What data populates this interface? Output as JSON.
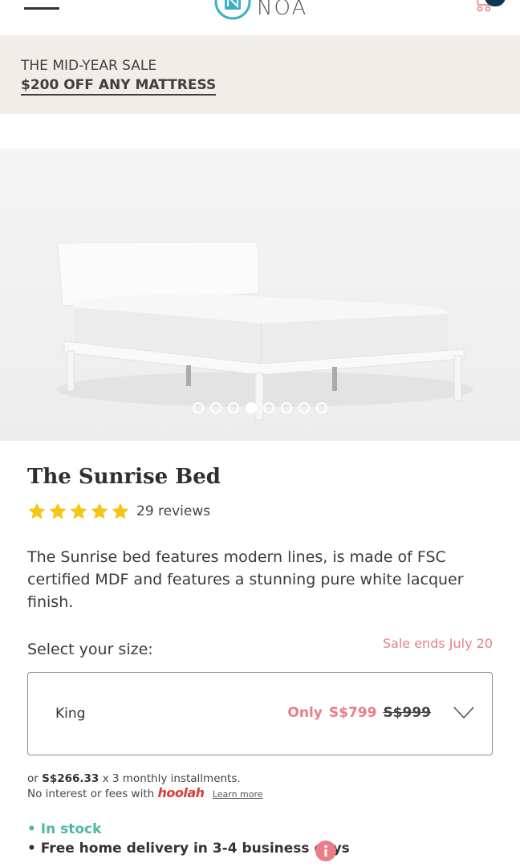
{
  "header": {
    "logo_text": "NOA",
    "cart_count": "0",
    "icons": {
      "menu": "hamburger-menu-icon",
      "cart": "cart-icon",
      "logo": "noa-logo-mark"
    }
  },
  "promo": {
    "line1": "THE MID-YEAR SALE",
    "line2": "$200 OFF ANY MATTRESS",
    "background": "#f1ede8"
  },
  "gallery": {
    "slide_count": 8,
    "active_index": 3
  },
  "product": {
    "title": "The Sunrise Bed",
    "rating": 5,
    "reviews": "29 reviews",
    "description": "The Sunrise bed features modern lines, is made of FSC certified MDF and features a stunning pure white lacquer finish."
  },
  "size": {
    "label": "Select your size:",
    "sale_ends": "Sale ends July 20",
    "selected": "King",
    "only": "Only",
    "price_now": "S$799",
    "price_was": "S$999"
  },
  "installments": {
    "prefix": "or",
    "amount": "S$266.33",
    "suffix": "x 3 monthly installments.",
    "line2": "No interest or fees with",
    "provider": "hoolah",
    "learn_more": "Learn more"
  },
  "availability": {
    "stock": "• In stock",
    "delivery": "• Free home delivery in 3-4 business days"
  },
  "colors": {
    "accent_pink": "#ea7e88",
    "stock_green": "#4fb8a4",
    "navy": "#0f3554",
    "star_yellow": "#f5c518"
  }
}
